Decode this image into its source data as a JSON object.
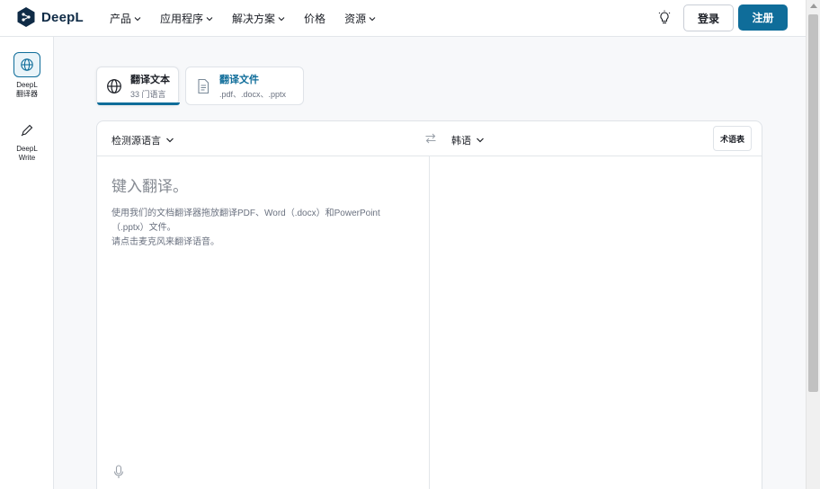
{
  "header": {
    "brand": "DeepL",
    "nav": [
      {
        "label": "产品",
        "has_dropdown": true
      },
      {
        "label": "应用程序",
        "has_dropdown": true
      },
      {
        "label": "解决方案",
        "has_dropdown": true
      },
      {
        "label": "价格",
        "has_dropdown": false
      },
      {
        "label": "资源",
        "has_dropdown": true
      }
    ],
    "login_label": "登录",
    "signup_label": "注册"
  },
  "sidebar": {
    "items": [
      {
        "line1": "DeepL",
        "line2": "翻译器",
        "icon": "globe-icon",
        "active": true
      },
      {
        "line1": "DeepL",
        "line2": "Write",
        "icon": "pen-icon",
        "active": false
      }
    ]
  },
  "tabs": {
    "text": {
      "title": "翻译文本",
      "subtitle": "33 门语言",
      "icon": "globe-icon"
    },
    "file": {
      "title": "翻译文件",
      "subtitle": ".pdf、.docx、.pptx",
      "icon": "document-icon"
    }
  },
  "translator": {
    "source_lang": "检测源语言",
    "target_lang": "韩语",
    "glossary_label": "术语表",
    "placeholder": "键入翻译。",
    "hint_line1": "使用我们的文档翻译器拖放翻译PDF、Word（.docx）和PowerPoint",
    "hint_line2": "（.pptx）文件。",
    "hint_line3": "请点击麦克风来翻译语音。"
  },
  "colors": {
    "accent": "#0f6d9a",
    "brand_dark": "#0f2b46"
  }
}
